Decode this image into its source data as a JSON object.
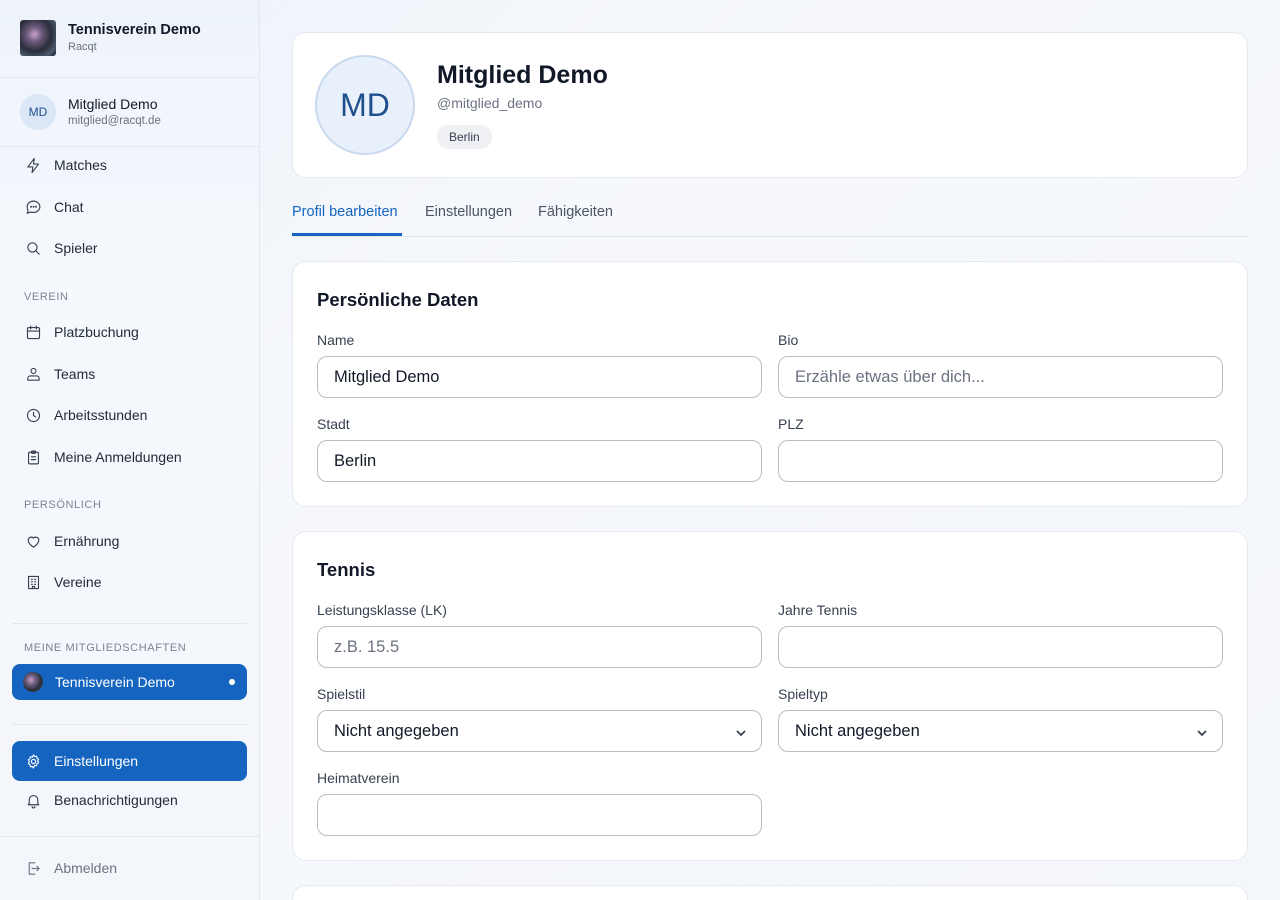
{
  "brand": {
    "name": "Tennisverein Demo",
    "sub": "Racqt"
  },
  "user": {
    "initials": "MD",
    "name": "Mitglied Demo",
    "email": "mitglied@racqt.de"
  },
  "nav": {
    "main": [
      {
        "label": "Matches",
        "icon": "bolt-icon"
      },
      {
        "label": "Chat",
        "icon": "chat-icon"
      },
      {
        "label": "Spieler",
        "icon": "search-icon"
      }
    ],
    "verein_label": "VEREIN",
    "verein": [
      {
        "label": "Platzbuchung",
        "icon": "calendar-icon"
      },
      {
        "label": "Teams",
        "icon": "team-icon"
      },
      {
        "label": "Arbeitsstunden",
        "icon": "clock-icon"
      },
      {
        "label": "Meine Anmeldungen",
        "icon": "clipboard-icon"
      }
    ],
    "persoenlich_label": "PERSÖNLICH",
    "persoenlich": [
      {
        "label": "Ernährung",
        "icon": "heart-icon"
      },
      {
        "label": "Vereine",
        "icon": "building-icon"
      }
    ],
    "memberships_label": "MEINE MITGLIEDSCHAFTEN",
    "membership": "Tennisverein Demo",
    "settings": "Einstellungen",
    "notifications": "Benachrichtigungen",
    "logout": "Abmelden"
  },
  "profile": {
    "initials": "MD",
    "name": "Mitglied Demo",
    "handle": "@mitglied_demo",
    "city_badge": "Berlin"
  },
  "tabs": [
    "Profil bearbeiten",
    "Einstellungen",
    "Fähigkeiten"
  ],
  "personal": {
    "title": "Persönliche Daten",
    "name_label": "Name",
    "name_value": "Mitglied Demo",
    "bio_label": "Bio",
    "bio_placeholder": "Erzähle etwas über dich...",
    "city_label": "Stadt",
    "city_value": "Berlin",
    "zip_label": "PLZ",
    "zip_value": ""
  },
  "tennis": {
    "title": "Tennis",
    "lk_label": "Leistungsklasse (LK)",
    "lk_placeholder": "z.B. 15.5",
    "years_label": "Jahre Tennis",
    "years_value": "",
    "style_label": "Spielstil",
    "style_value": "Nicht angegeben",
    "type_label": "Spieltyp",
    "type_value": "Nicht angegeben",
    "club_label": "Heimatverein",
    "club_value": ""
  },
  "colors": {
    "accent": "#1565c0",
    "text": "#111827",
    "muted": "#6b7280"
  }
}
